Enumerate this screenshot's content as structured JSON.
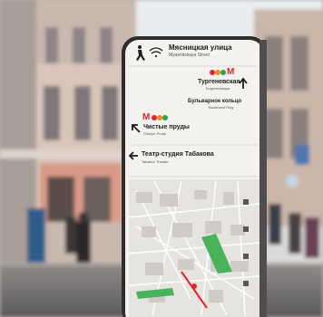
{
  "sign": {
    "street_name": "Мясницкая улица",
    "street_name_latin": "Myasnitskaya Street",
    "metro_badge_1": "M",
    "destination_1": "Тургеневская",
    "destination_1_latin": "Turgenevskaya",
    "destination_2": "Бульварное кольцо",
    "destination_2_latin": "Boulevard Ring",
    "metro_badge_2": "M",
    "destination_3": "Чистые пруды",
    "destination_3_latin": "Chistye Prudy",
    "destination_4": "Театр-студия Табакова",
    "destination_4_latin": "Tabakov Theater"
  },
  "colors": {
    "metro_red": "#e0252f",
    "metro_orange": "#f08a24",
    "metro_green": "#2fa24a",
    "sign_frame": "#2f2c2e",
    "sign_face": "#f3f2ef",
    "map_park": "#49b35a"
  },
  "icons": {
    "pedestrian": "pedestrian-icon",
    "wifi": "wifi-icon",
    "arrow_up": "arrow-up-icon",
    "arrow_up_left": "arrow-up-left-icon",
    "arrow_left": "arrow-left-icon"
  }
}
